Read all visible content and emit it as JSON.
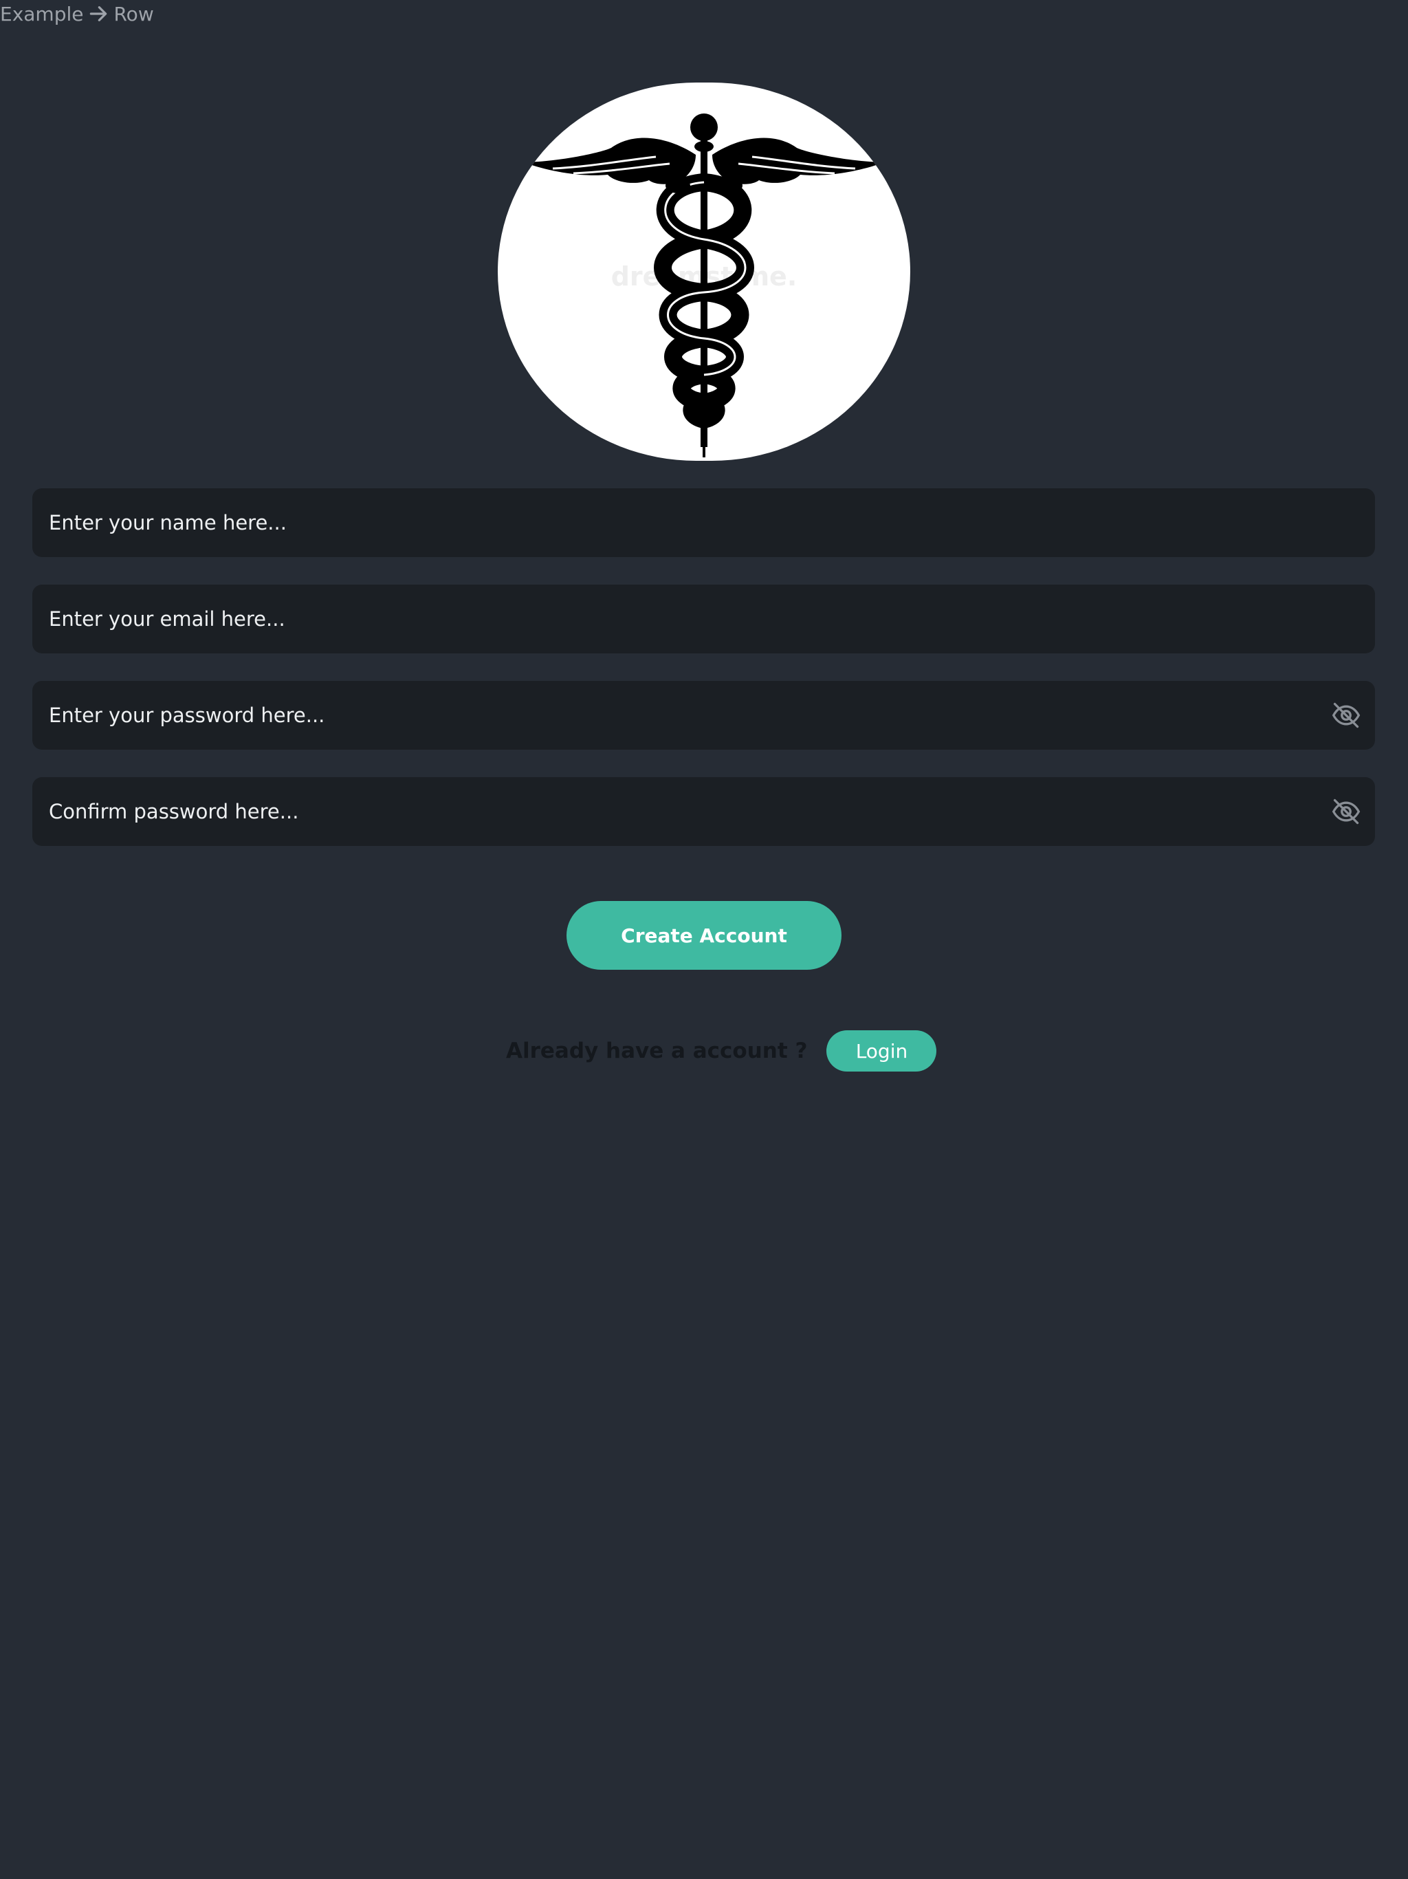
{
  "breadcrumb": {
    "parent": "Example",
    "current": "Row"
  },
  "logo": {
    "watermark": "dreamstime."
  },
  "form": {
    "name_placeholder": "Enter your name here...",
    "email_placeholder": "Enter your email here...",
    "password_placeholder": "Enter your password here...",
    "confirm_placeholder": "Confirm password here...",
    "create_label": "Create Account"
  },
  "footer": {
    "question": "Already have a account ?",
    "login_label": "Login"
  },
  "colors": {
    "background": "#262c35",
    "field": "#1b1f24",
    "accent": "#3fbaa1"
  },
  "icons": {
    "breadcrumb_separator": "arrow-right-icon",
    "password_toggle": "eye-off-icon",
    "logo": "caduceus-icon"
  }
}
